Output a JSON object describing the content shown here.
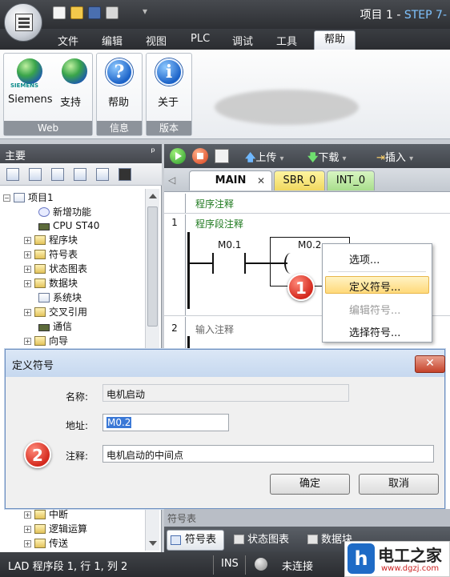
{
  "window": {
    "title_prefix": "项目 1 - ",
    "title_accent": "STEP 7-"
  },
  "menu": {
    "tabs": [
      "文件",
      "编辑",
      "视图",
      "PLC",
      "调试",
      "工具",
      "帮助"
    ],
    "active": "帮助"
  },
  "ribbon": {
    "groups": [
      {
        "label": "Web",
        "buttons": [
          "Siemens",
          "支持"
        ]
      },
      {
        "label": "信息",
        "buttons": [
          "帮助"
        ]
      },
      {
        "label": "版本",
        "buttons": [
          "关于"
        ]
      }
    ],
    "siemens_logo_text": "SIEMENS"
  },
  "left_panel": {
    "title": "主要",
    "pin": "ᵖ",
    "tree": [
      {
        "label": "项目1",
        "expander": "−"
      },
      {
        "label": "新增功能"
      },
      {
        "label": "CPU ST40"
      },
      {
        "label": "程序块",
        "expander": "+"
      },
      {
        "label": "符号表",
        "expander": "+"
      },
      {
        "label": "状态图表",
        "expander": "+"
      },
      {
        "label": "数据块",
        "expander": "+"
      },
      {
        "label": "系统块"
      },
      {
        "label": "交叉引用",
        "expander": "+"
      },
      {
        "label": "通信"
      },
      {
        "label": "向导",
        "expander": "+"
      }
    ],
    "tree_bottom": [
      {
        "label": "中断",
        "expander": "+"
      },
      {
        "label": "逻辑运算",
        "expander": "+"
      },
      {
        "label": "传送",
        "expander": "+"
      }
    ]
  },
  "editor_toolbar": {
    "upload": "上传",
    "download": "下载",
    "insert": "插入"
  },
  "editor_tabs": {
    "main": "MAIN",
    "close": "✕",
    "sbr": "SBR_0",
    "int": "INT_0"
  },
  "editor": {
    "program_comment": "程序注释",
    "network1_num": "1",
    "network1_comment": "程序段注释",
    "contact1": "M0.1",
    "contact2": "M0.2",
    "network2_num": "2",
    "network2_comment": "输入注释"
  },
  "context_menu": {
    "items": [
      "选项...",
      "定义符号...",
      "编辑符号...",
      "选择符号..."
    ],
    "highlighted": 1
  },
  "badges": {
    "step1": "1",
    "step2": "2"
  },
  "dialog": {
    "title": "定义符号",
    "close": "✕",
    "name_label": "名称:",
    "name_value": "电机启动",
    "address_label": "地址:",
    "address_value": "M0.2",
    "comment_label": "注释:",
    "comment_value": "电机启动的中间点",
    "ok": "确定",
    "cancel": "取消"
  },
  "behind_dialog_text": "符号表",
  "bottom_tabs": [
    "符号表",
    "状态图表",
    "数据块"
  ],
  "statusbar": {
    "position": "LAD 程序段 1, 行 1, 列 2",
    "mode": "INS",
    "connection": "未连接"
  },
  "watermark": {
    "logo": "h",
    "title": "电工之家",
    "url": "www.dgzj.com"
  }
}
